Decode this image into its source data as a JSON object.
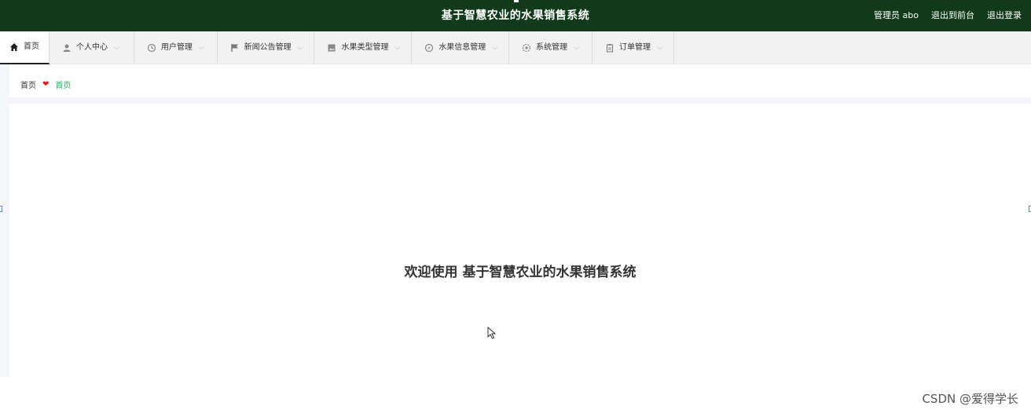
{
  "header": {
    "title": "基于智慧农业的水果销售系统",
    "user_label": "管理员 abo",
    "to_front_label": "退出到前台",
    "logout_label": "退出登录",
    "bg_color": "#113a1a"
  },
  "nav": {
    "items": [
      {
        "label": "首页",
        "icon": "home-icon"
      },
      {
        "label": "个人中心",
        "icon": "user-icon"
      },
      {
        "label": "用户管理",
        "icon": "clock-icon"
      },
      {
        "label": "新闻公告管理",
        "icon": "flag-icon"
      },
      {
        "label": "水果类型管理",
        "icon": "image-icon"
      },
      {
        "label": "水果信息管理",
        "icon": "compass-icon"
      },
      {
        "label": "系统管理",
        "icon": "settings-icon"
      },
      {
        "label": "订单管理",
        "icon": "clipboard-icon"
      }
    ]
  },
  "breadcrumb": {
    "root": "首页",
    "current": "首页"
  },
  "main": {
    "welcome": "欢迎使用 基于智慧农业的水果销售系统"
  },
  "watermark": "CSDN @爱得学长"
}
